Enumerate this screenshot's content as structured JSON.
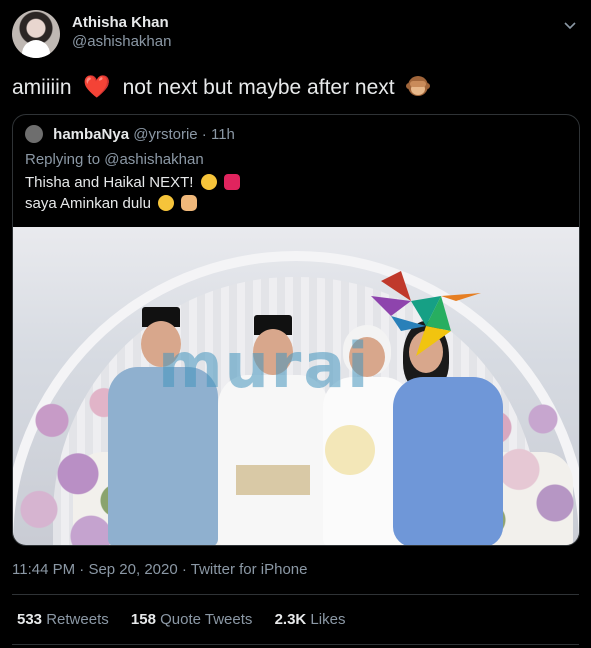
{
  "author": {
    "display_name": "Athisha Khan",
    "handle": "@ashishakhan"
  },
  "tweet": {
    "text_part1": "amiiiin",
    "heart_emoji": "❤️",
    "text_part2": "not next but maybe after next",
    "trailing_emoji": "see-no-evil-monkey"
  },
  "quoted": {
    "display_name": "hambaNya",
    "handle": "@yrstorie",
    "separator": "·",
    "time": "11h",
    "replying_to_prefix": "Replying to ",
    "replying_to_handle": "@ashishakhan",
    "line1": "Thisha and Haikal NEXT!",
    "line1_emojis": [
      "winking-crazy-face",
      "sparkling-heart"
    ],
    "line2": "saya Aminkan dulu",
    "line2_emojis": [
      "smiling-face-hearts",
      "folded-hands"
    ],
    "watermark": "murai"
  },
  "meta": {
    "time": "11:44 PM",
    "separator1": "·",
    "date": "Sep 20, 2020",
    "separator2": "·",
    "source": "Twitter for iPhone"
  },
  "stats": {
    "retweets_count": "533",
    "retweets_label": "Retweets",
    "quote_count": "158",
    "quote_label": "Quote Tweets",
    "likes_count": "2.3K",
    "likes_label": "Likes"
  },
  "colors": {
    "background": "#000000",
    "text_primary": "#e7e9ea",
    "text_secondary": "#8b98a5",
    "border": "#2f3336",
    "heart": "#e0245e"
  }
}
